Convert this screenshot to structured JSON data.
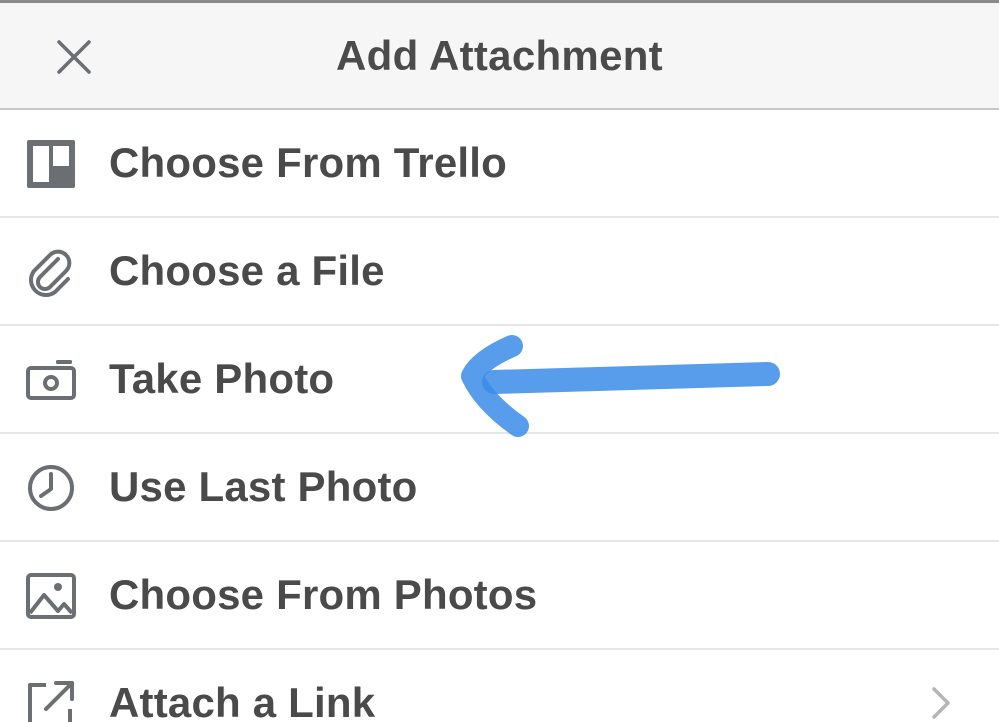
{
  "header": {
    "title": "Add Attachment",
    "close_icon": "close-icon"
  },
  "menu": {
    "items": [
      {
        "label": "Choose From Trello",
        "icon": "trello-board-icon"
      },
      {
        "label": "Choose a File",
        "icon": "paperclip-icon"
      },
      {
        "label": "Take Photo",
        "icon": "camera-icon"
      },
      {
        "label": "Use Last Photo",
        "icon": "clock-icon"
      },
      {
        "label": "Choose From Photos",
        "icon": "photo-icon"
      },
      {
        "label": "Attach a Link",
        "icon": "external-link-icon",
        "chevron": "chevron-right-icon"
      }
    ]
  },
  "annotation": {
    "type": "hand-drawn arrow",
    "points_to": "Take Photo",
    "color": "#3b8ce8"
  },
  "colors": {
    "icon": "#6b6e73",
    "text": "#4a4a4a",
    "header_bg": "#f6f6f6",
    "divider": "#e6e6e6"
  }
}
